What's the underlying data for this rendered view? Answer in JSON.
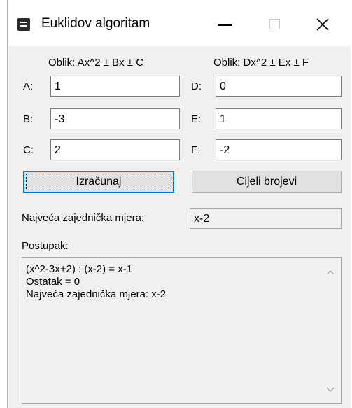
{
  "window": {
    "title": "Euklidov algoritam",
    "app_icon": "form-icon",
    "controls": [
      "minimize-icon",
      "maximize-icon",
      "close-icon"
    ]
  },
  "form_left": {
    "header": "Oblik: Ax^2 ± Bx ± C",
    "fields": [
      {
        "label": "A:",
        "value": "1"
      },
      {
        "label": "B:",
        "value": "-3"
      },
      {
        "label": "C:",
        "value": "2"
      }
    ]
  },
  "form_right": {
    "header": "Oblik: Dx^2 ± Ex ± F",
    "fields": [
      {
        "label": "D:",
        "value": "0"
      },
      {
        "label": "E:",
        "value": "1"
      },
      {
        "label": "F:",
        "value": "-2"
      }
    ]
  },
  "buttons": {
    "calculate": "Izračunaj",
    "integers": "Cijeli brojevi"
  },
  "gcd": {
    "label": "Najveća zajednička mjera:",
    "value": "x-2"
  },
  "steps": {
    "label": "Postupak:",
    "lines": [
      "(x^2-3x+2) : (x-2) = x-1",
      "Ostatak = 0",
      "Najveća zajednička mjera: x-2"
    ]
  },
  "colors": {
    "window_bg": "#f0f0f0",
    "default_button_border": "#0078d7"
  }
}
